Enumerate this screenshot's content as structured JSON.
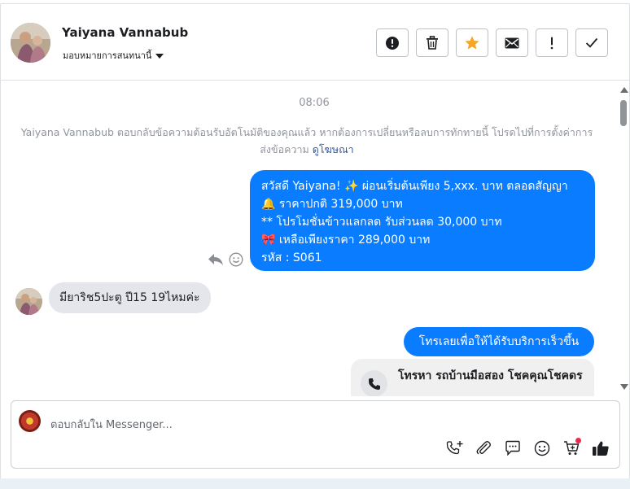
{
  "header": {
    "contact_name": "Yaiyana Vannabub",
    "assign_label": "มอบหมายการสนทนานี้"
  },
  "toolbar": {
    "buttons": [
      {
        "name": "spam-button",
        "icon": "alert-circle-icon"
      },
      {
        "name": "delete-button",
        "icon": "trash-icon"
      },
      {
        "name": "star-button",
        "icon": "star-icon",
        "color": "#f5a623"
      },
      {
        "name": "mark-unread-button",
        "icon": "envelope-icon"
      },
      {
        "name": "follow-up-button",
        "icon": "exclamation-icon"
      },
      {
        "name": "mark-done-button",
        "icon": "check-icon"
      }
    ]
  },
  "conversation": {
    "time": "08:06",
    "notice_text": "Yaiyana Vannabub ตอบกลับข้อความต้อนรับอัตโนมัติของคุณแล้ว หากต้องการเปลี่ยนหรือลบการทักทายนี้ โปรดไปที่การตั้งค่าการส่งข้อความ",
    "notice_link": "ดูโฆษณา",
    "outgoing_1": {
      "line1": "สวัสดี Yaiyana! ✨  ผ่อนเริ่มต้นเพียง 5,xxx. บาท ตลอดสัญญา",
      "line2": "🔔 ราคาปกติ 319,000 บาท",
      "line3": "** โปรโมชั่นข้าวแลกลด รับส่วนลด 30,000 บาท",
      "line4": "🎀  เหลือเพียงราคา 289,000 บาท",
      "line5": " รหัส : S061"
    },
    "incoming_1": "มียาริช5ปะตู ปี15 19ไหมค่ะ",
    "outgoing_2": "โทรเลยเพื่อให้ได้รับบริการเร็วขึ้น",
    "call_card": "โทรหา รถบ้านมือสอง โชคคุณโชคดร"
  },
  "composer": {
    "placeholder": "ตอบกลับใน Messenger...",
    "icons": [
      "add-call-icon",
      "attachment-icon",
      "saved-replies-icon",
      "emoji-icon",
      "shop-cart-icon",
      "thumbs-up-icon"
    ]
  },
  "colors": {
    "accent": "#0a7cff",
    "incoming_bubble": "#e4e6eb",
    "star": "#f5a623"
  }
}
